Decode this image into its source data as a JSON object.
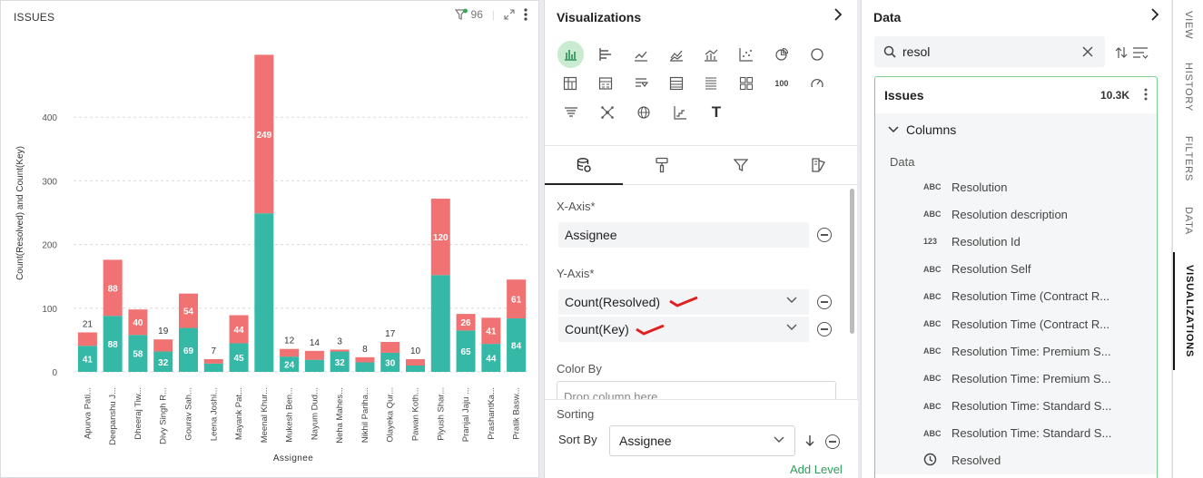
{
  "chart_panel": {
    "title": "ISSUES",
    "filter_count": "96"
  },
  "chart_data": {
    "type": "bar",
    "stacked": true,
    "xlabel": "Assignee",
    "ylabel": "Count(Resolved) and Count(Key)",
    "ylim": [
      0,
      500
    ],
    "yticks": [
      0,
      100,
      200,
      300,
      400
    ],
    "categories": [
      "Apurva Pati...",
      "Deepanshu J...",
      "Dheeraj Tiw...",
      "Divy Singh R...",
      "Gourav Sah...",
      "Leena Joshi...",
      "Mayank Pat...",
      "Meenal Khur...",
      "Mukesh Ben...",
      "Nayum Dud...",
      "Neha Mahes...",
      "Nikhil Pariha...",
      "Olayeka Qur...",
      "Pawan Koth...",
      "Piyush Shar...",
      "Pranjal Jaju ...",
      "PrashantKa...",
      "Pratik Basw..."
    ],
    "series": [
      {
        "name": "Count(Resolved)",
        "color": "#35b8a6",
        "values": [
          41,
          88,
          58,
          32,
          69,
          13,
          45,
          249,
          24,
          19,
          32,
          15,
          30,
          10,
          152,
          65,
          44,
          84
        ],
        "labels": [
          "41",
          "88",
          "58",
          "32",
          "69",
          "",
          "45",
          "",
          "24",
          "",
          "32",
          "",
          "30",
          "",
          "",
          "65",
          "44",
          "84"
        ]
      },
      {
        "name": "Count(Key)",
        "color": "#f07272",
        "values": [
          21,
          88,
          40,
          19,
          54,
          7,
          44,
          249,
          12,
          14,
          3,
          8,
          17,
          10,
          120,
          26,
          41,
          61
        ],
        "labels": [
          "21",
          "88",
          "40",
          "19",
          "54",
          "7",
          "44",
          "249",
          "12",
          "14",
          "3",
          "8",
          "17",
          "10",
          "120",
          "26",
          "41",
          "61"
        ]
      }
    ],
    "grid": true,
    "legend": "none"
  },
  "viz_panel": {
    "title": "Visualizations",
    "number_icon_text": "100",
    "text_icon_text": "T",
    "x_axis_label": "X-Axis*",
    "x_axis_value": "Assignee",
    "y_axis_label": "Y-Axis*",
    "y_axis_values": [
      "Count(Resolved)",
      "Count(Key)"
    ],
    "color_by_label": "Color By",
    "color_by_placeholder": "Drop column here",
    "sorting_label": "Sorting",
    "sort_by_label": "Sort By",
    "sort_by_value": "Assignee",
    "add_level": "Add Level"
  },
  "data_panel": {
    "title": "Data",
    "search_value": "resol",
    "dataset_name": "Issues",
    "dataset_count": "10.3K",
    "columns_label": "Columns",
    "section_label": "Data",
    "columns": [
      {
        "type": "ABC",
        "name": "Resolution"
      },
      {
        "type": "ABC",
        "name": "Resolution description"
      },
      {
        "type": "123",
        "name": "Resolution Id"
      },
      {
        "type": "ABC",
        "name": "Resolution Self"
      },
      {
        "type": "ABC",
        "name": "Resolution Time (Contract R..."
      },
      {
        "type": "ABC",
        "name": "Resolution Time (Contract R..."
      },
      {
        "type": "ABC",
        "name": "Resolution Time: Premium S..."
      },
      {
        "type": "ABC",
        "name": "Resolution Time: Premium S..."
      },
      {
        "type": "ABC",
        "name": "Resolution Time: Standard S..."
      },
      {
        "type": "ABC",
        "name": "Resolution Time: Standard S..."
      },
      {
        "type": "clock-icon",
        "name": "Resolved"
      }
    ]
  },
  "side_tabs": [
    "VIEW",
    "HISTORY",
    "FILTERS",
    "DATA",
    "VISUALIZATIONS"
  ],
  "colors": {
    "accent": "#2e9e5b",
    "resolved": "#35b8a6",
    "key": "#f07272",
    "annotation": "#e02020"
  }
}
